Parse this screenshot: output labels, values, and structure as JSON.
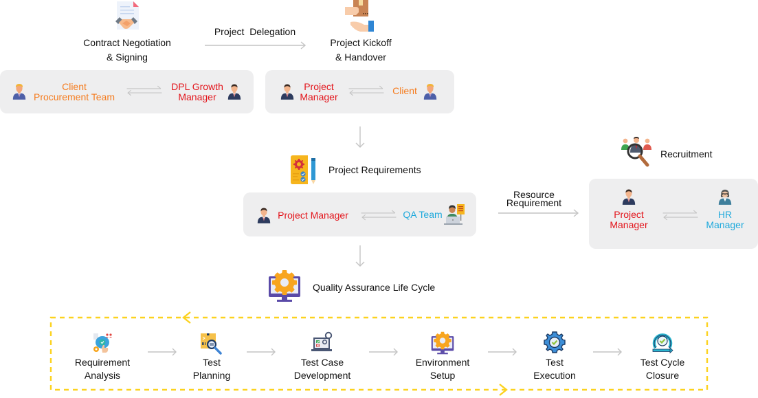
{
  "stages": {
    "contract": {
      "title_line1": "Contract Negotiation",
      "title_line2": "& Signing",
      "icon": "handshake-contract-icon"
    },
    "kickoff": {
      "title_line1": "Project Kickoff",
      "title_line2": "& Handover",
      "icon": "package-handover-icon"
    },
    "requirements": {
      "title": "Project Requirements",
      "icon": "requirements-document-icon"
    },
    "recruitment": {
      "title": "Recruitment",
      "icon": "recruitment-search-icon"
    },
    "qalc": {
      "title": "Quality Assurance Life Cycle",
      "icon": "monitor-gear-icon"
    }
  },
  "edges": {
    "delegation": "Project  Delegation",
    "resource_line1": "Resource",
    "resource_line2": "Requirement"
  },
  "panels": {
    "contract": {
      "left": {
        "line1": "Client",
        "line2": "Procurement Team",
        "color": "#f57c1f"
      },
      "right": {
        "line1": "DPL Growth",
        "line2": "Manager",
        "color": "#e3141b"
      }
    },
    "kickoff": {
      "left": {
        "line1": "Project",
        "line2": "Manager",
        "color": "#e3141b"
      },
      "right": {
        "line1": "Client",
        "color": "#f57c1f"
      }
    },
    "requirements": {
      "left": {
        "line1": "Project Manager",
        "color": "#e3141b"
      },
      "right": {
        "line1": "QA Team",
        "color": "#1fa9dc"
      }
    },
    "recruitment": {
      "left": {
        "line1": "Project",
        "line2": "Manager",
        "color": "#e3141b"
      },
      "right": {
        "line1": "HR",
        "line2": "Manager",
        "color": "#1fa9dc"
      }
    }
  },
  "qa_steps": [
    {
      "line1": "Requirement",
      "line2": "Analysis",
      "icon": "requirement-analysis-icon"
    },
    {
      "line1": "Test",
      "line2": "Planning",
      "icon": "test-planning-icon"
    },
    {
      "line1": "Test Case",
      "line2": "Development",
      "icon": "test-case-development-icon"
    },
    {
      "line1": "Environment",
      "line2": "Setup",
      "icon": "environment-setup-icon"
    },
    {
      "line1": "Test",
      "line2": "Execution",
      "icon": "test-execution-icon"
    },
    {
      "line1": "Test Cycle",
      "line2": "Closure",
      "icon": "test-cycle-closure-icon"
    }
  ],
  "colors": {
    "panel_bg": "#eeeeef",
    "arrow": "#c8c8c8",
    "loop": "#fcd21f",
    "red": "#e3141b",
    "orange": "#f57c1f",
    "blue": "#1fa9dc"
  }
}
